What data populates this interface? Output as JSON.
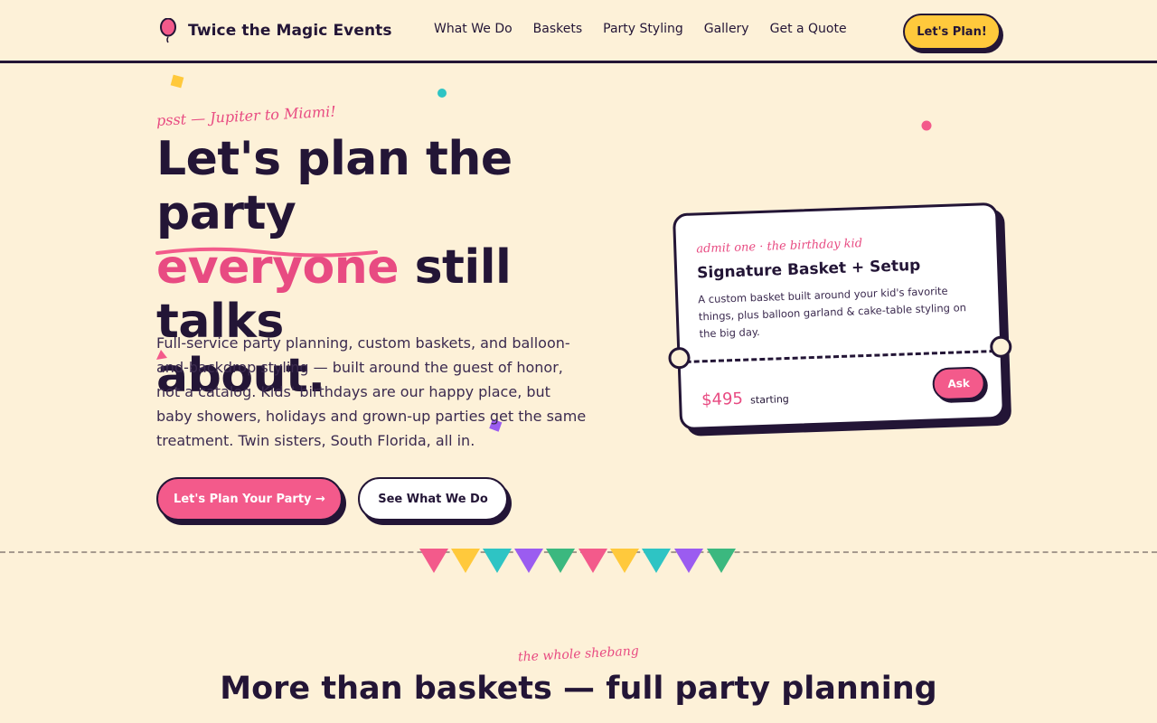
{
  "header": {
    "brand": "Twice the Magic Events",
    "nav": [
      "What We Do",
      "Baskets",
      "Party Styling",
      "Gallery",
      "Get a Quote"
    ],
    "cta": "Let's Plan!"
  },
  "hero": {
    "kicker": "psst — Jupiter to Miami!",
    "headline_line1": "Let's plan the party",
    "headline_accent": "everyone",
    "headline_rest": " still talks",
    "headline_line3": "about.",
    "lead": "Full-service party planning, custom baskets, and balloon-and-backdrop styling — built around the guest of honor, not a catalog. Kids' birthdays are our happy place, but baby showers, holidays and grown-up parties get the same treatment. Twin sisters, South Florida, all in.",
    "primary_button": "Let's Plan Your Party →",
    "secondary_button": "See What We Do"
  },
  "ticket": {
    "admit": "admit one · the birthday kid",
    "title": "Signature Basket + Setup",
    "description": "A custom basket built around your kid's favorite things, plus balloon garland & cake-table styling on the big day.",
    "price": "$495",
    "price_suffix": "starting",
    "button": "Ask"
  },
  "section2": {
    "kicker": "the whole shebang",
    "heading": "More than baskets — full party planning"
  },
  "colors": {
    "background": "#fdf1d8",
    "ink": "#231536",
    "pink": "#f35a8b",
    "yellow": "#ffc93c",
    "teal": "#2ec4c4",
    "purple": "#9b5cf0",
    "green": "#3bb87f"
  },
  "icons": {
    "brand": "balloon-icon"
  }
}
